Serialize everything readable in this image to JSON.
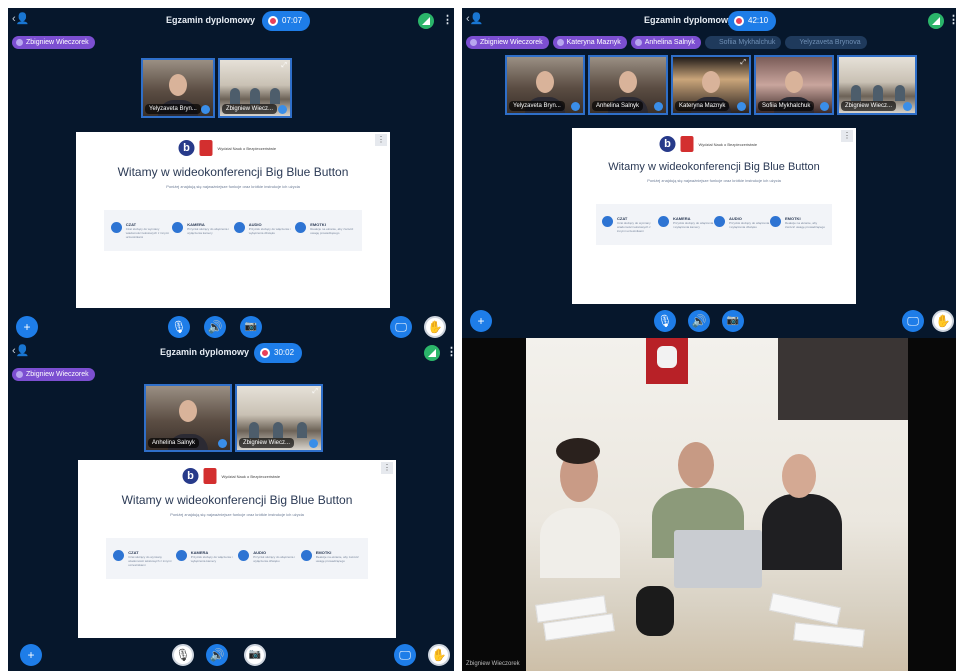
{
  "session": {
    "title": "Egzamin dyplomowy",
    "timers": [
      "07:07",
      "42:10",
      "30:02"
    ]
  },
  "q1": {
    "chips": [
      "Zbigniew Wieczorek"
    ],
    "tiles": [
      "Yelyzaveta Bryn...",
      "Zbigniew Wiecz..."
    ]
  },
  "q2": {
    "chips": [
      "Zbigniew Wieczorek",
      "Kateryna Maznyk",
      "Anhelina Salnyk",
      "Sofiia Mykhalchuk",
      "Yelyzaveta Brynova"
    ],
    "tiles": [
      "Yelyzaveta Bryn...",
      "Anhelina Salnyk",
      "Kateryna Maznyk",
      "Sofiia Mykhalchuk",
      "Zbigniew Wiecz..."
    ]
  },
  "q3": {
    "chips": [
      "Zbigniew Wieczorek"
    ],
    "tiles": [
      "Anhelina Salnyk",
      "Zbigniew Wiecz..."
    ]
  },
  "slide": {
    "bbb_letter": "b",
    "institution": "Wydział Nauk o Bezpieczeństwie",
    "heading": "Witamy w wideokonferencji Big Blue Button",
    "subheading": "Poniżej znajdują się najważniejsze funkcje oraz krótkie instrukcje ich użycia",
    "features": [
      {
        "name": "CZAT",
        "desc": "Czat służący do wymiany wiadomości tekstowych z innymi uczestnikami"
      },
      {
        "name": "KAMERA",
        "desc": "Przycisk służący do włączenia i wyłączenia kamery"
      },
      {
        "name": "AUDIO",
        "desc": "Przycisk służący do włączenia i wyłączenia dźwięku"
      },
      {
        "name": "EMOTKI",
        "desc": "Reakcje na ekranie, aby zwrócić uwagę prowadzącego"
      }
    ]
  },
  "video": {
    "label": "Zbigniew Wieczorek"
  },
  "icons": {
    "plus": "+",
    "mic": "🎙",
    "speaker": "🔊",
    "camera": "📷",
    "screen": "🖵",
    "hand": "✋",
    "menu": "⋮",
    "user": "👤"
  }
}
